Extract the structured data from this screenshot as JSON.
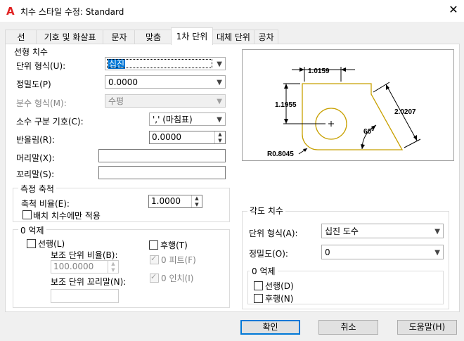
{
  "window": {
    "title": "치수 스타일 수정: Standard",
    "app_icon": "A",
    "close_glyph": "✕"
  },
  "tabs": [
    "선",
    "기호 및 화살표",
    "문자",
    "맞춤",
    "1차 단위",
    "대체 단위",
    "공차"
  ],
  "active_tab": "1차 단위",
  "linear": {
    "group_label": "선형 치수",
    "unit_format": {
      "label": "단위 형식(U):",
      "value": "십진"
    },
    "precision": {
      "label": "정밀도(P)",
      "value": "0.0000"
    },
    "fraction_format": {
      "label": "분수 형식(M):",
      "value": "수평"
    },
    "decimal_separator": {
      "label": "소수 구분 기호(C):",
      "value": "','  (마침표)"
    },
    "round_off": {
      "label": "반올림(R):",
      "value": "0.0000"
    },
    "prefix": {
      "label": "머리말(X):",
      "value": ""
    },
    "suffix": {
      "label": "꼬리말(S):",
      "value": ""
    }
  },
  "measurement_scale": {
    "group_label": "측정 축척",
    "scale_factor": {
      "label": "축척 비율(E):",
      "value": "1.0000"
    },
    "layout_only": {
      "label": "배치 치수에만 적용",
      "checked": false
    }
  },
  "zero_suppression": {
    "group_label": "0 억제",
    "leading": {
      "label": "선행(L)",
      "checked": false
    },
    "trailing": {
      "label": "후행(T)",
      "checked": false
    },
    "sub_unit_factor": {
      "label": "보조 단위 비율(B):",
      "value": "100.0000"
    },
    "zero_feet": {
      "label": "0 피트(F)",
      "checked": true
    },
    "sub_unit_suffix": {
      "label": "보조 단위 꼬리말(N):",
      "value": ""
    },
    "zero_inches": {
      "label": "0 인치(I)",
      "checked": true
    }
  },
  "preview": {
    "dim_top": "1.0159",
    "dim_left": "1.1955",
    "dim_right": "2.0207",
    "dim_angle": "60°",
    "dim_radius": "R0.8045",
    "colors": {
      "part": "#c8a000",
      "dims": "#000000"
    }
  },
  "angular": {
    "group_label": "각도 치수",
    "unit_format": {
      "label": "단위 형식(A):",
      "value": "십진 도수"
    },
    "precision": {
      "label": "정밀도(O):",
      "value": "0"
    },
    "zero_group_label": "0 억제",
    "leading": {
      "label": "선행(D)",
      "checked": false
    },
    "trailing": {
      "label": "후행(N)",
      "checked": false
    }
  },
  "buttons": {
    "ok": "확인",
    "cancel": "취소",
    "help": "도움말(H)"
  },
  "icons": {
    "dropdown": "chevron-down-icon",
    "spin": "spin-arrows-icon",
    "check": "check-icon",
    "close": "close-icon"
  },
  "accent_color": "#0078d7"
}
